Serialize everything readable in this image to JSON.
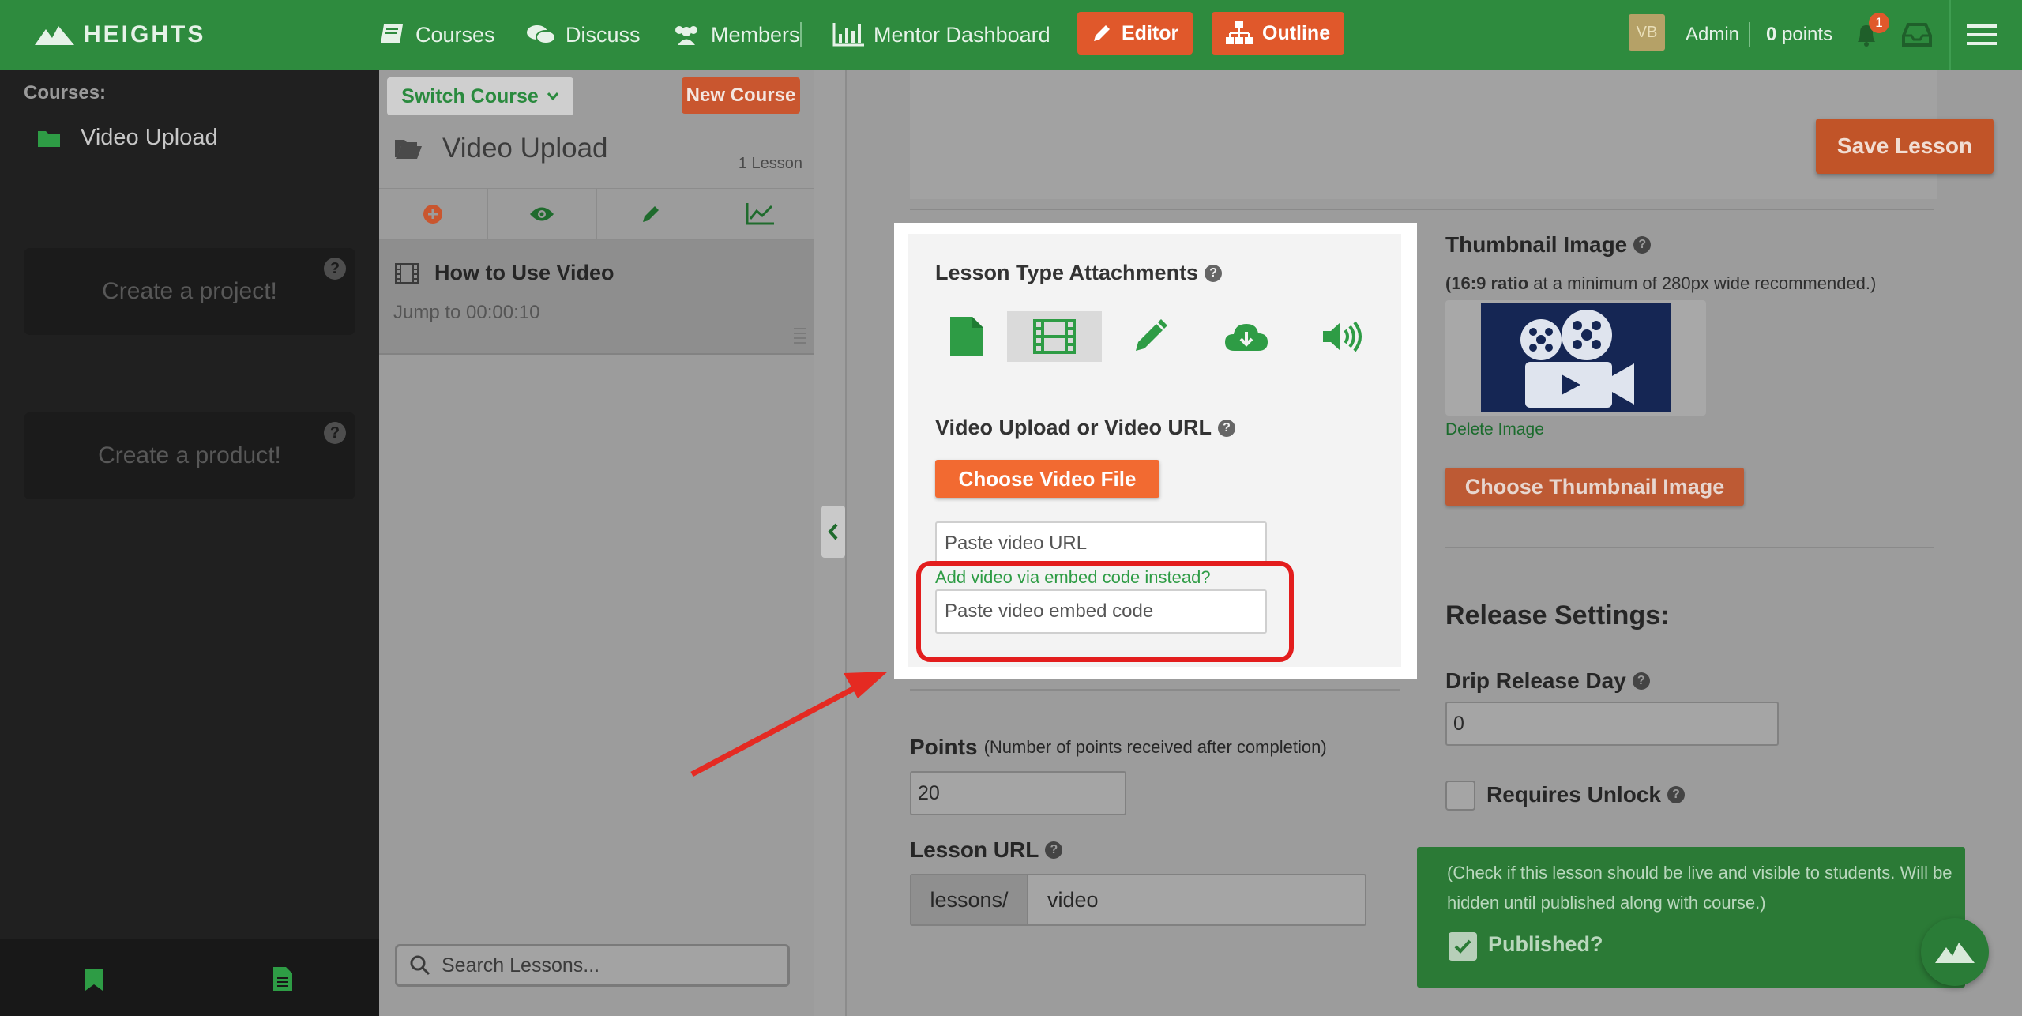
{
  "topbar": {
    "logo": "HEIGHTS",
    "nav": [
      "Courses",
      "Discuss",
      "Members",
      "Mentor Dashboard"
    ],
    "editor_label": "Editor",
    "outline_label": "Outline",
    "avatar_initials": "VB",
    "user_name": "Admin",
    "points_value": "0",
    "points_label": "points",
    "notification_count": "1"
  },
  "sidebar": {
    "heading": "Courses:",
    "course_name": "Video Upload",
    "project_cta": "Create a project!",
    "product_cta": "Create a product!",
    "help_glyph": "?"
  },
  "lesson_panel": {
    "switch_course": "Switch Course",
    "new_course": "New Course",
    "course_title": "Video Upload",
    "lesson_count": "1 Lesson",
    "lessons": [
      {
        "title": "How to Use Video",
        "subtitle": "Jump to 00:00:10"
      }
    ],
    "search_placeholder": "Search Lessons..."
  },
  "editor": {
    "save_label": "Save Lesson",
    "attachments_title": "Lesson Type Attachments",
    "video_label": "Video Upload or Video URL",
    "choose_video": "Choose Video File",
    "video_url_placeholder": "Paste video URL",
    "embed_link": "Add video via embed code instead?",
    "embed_placeholder": "Paste video embed code",
    "points_label": "Points",
    "points_note": "(Number of points received after completion)",
    "points_value": "20",
    "lesson_url_label": "Lesson URL",
    "url_prefix": "lessons/",
    "url_value": "video",
    "thumbnail_title": "Thumbnail Image",
    "thumbnail_ratio_bold": "(16:9 ratio",
    "thumbnail_ratio_rest": " at a minimum of 280px wide recommended.)",
    "delete_image": "Delete Image",
    "choose_thumbnail": "Choose Thumbnail Image",
    "release_title": "Release Settings:",
    "drip_label": "Drip Release Day",
    "drip_value": "0",
    "requires_unlock": "Requires Unlock",
    "published_note": "(Check if this lesson should be live and visible to students. Will be hidden until published along with course.)",
    "published_label": "Published?"
  },
  "colors": {
    "brand_green": "#2e8b3e",
    "accent_orange": "#f26a31",
    "annotation_red": "#e31d1d"
  }
}
